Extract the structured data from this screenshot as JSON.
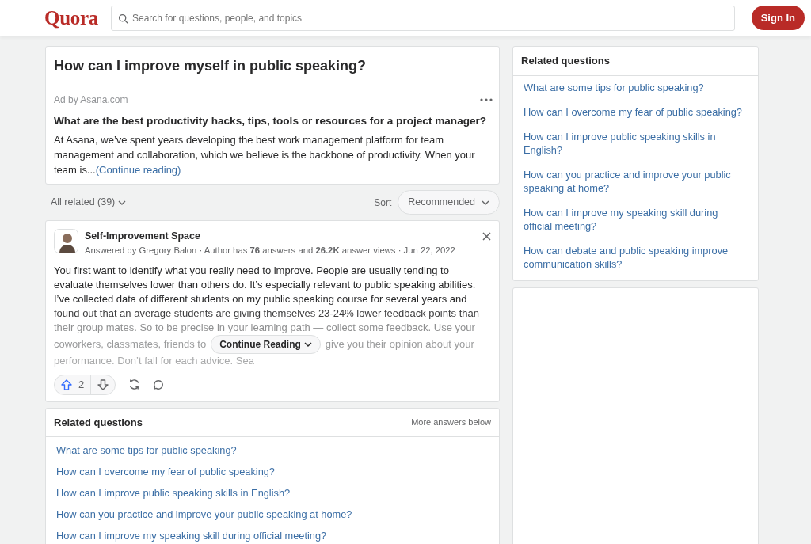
{
  "header": {
    "logo": "Quora",
    "search": {
      "placeholder": "Search for questions, people, and topics"
    },
    "sign_in": "Sign In"
  },
  "question": {
    "title": "How can I improve myself in public speaking?"
  },
  "ad": {
    "source": "Ad by Asana.com",
    "title": "What are the best productivity hacks, tips, tools or resources for a project manager?",
    "text": "At Asana, we’ve spent years developing the best work management platform for team management and collaboration, which we believe is the backbone of productivity. When your team is...",
    "link": "(Continue reading)"
  },
  "filter": {
    "label": "All related (39)",
    "sort_label": "Sort",
    "sort_value": "Recommended"
  },
  "answer": {
    "name": "Self-Improvement Space",
    "meta": "Answered by Gregory Balon · Author has **76** answers and **26.2K** answer views · Jun 22, 2022",
    "lines": [
      {
        "text": "You first want to identify what you really need to improve. People are usually tending to"
      },
      {
        "text": "evaluate themselves lower than others do. It’s especially relevant to public speaking abilities."
      },
      {
        "text": "I’ve collected data of different students on my public speaking course for several years and"
      },
      {
        "text": "found out that an average students are giving themselves 23-24% lower feedback points than"
      },
      {
        "text": "their group mates. So to be precise in your learning path — collect some feedback. Use your"
      }
    ],
    "cut_left": "coworkers, classmates, friends to",
    "cut_right": "give you their opinion about your",
    "last_line": "performance. Don’t fall for each advice. Sea",
    "continue": "Continue Reading",
    "upvotes": "2"
  },
  "related_inline": {
    "title": "Related questions",
    "note": "More answers below",
    "items": [
      "What are some tips for public speaking?",
      "How can I overcome my fear of public speaking?",
      "How can I improve public speaking skills in English?",
      "How can you practice and improve your public speaking at home?",
      "How can I improve my speaking skill during official meeting?"
    ]
  },
  "sidebar": {
    "title": "Related questions",
    "items": [
      "What are some tips for public speaking?",
      "How can I overcome my fear of public speaking?",
      "How can I improve public speaking skills in English?",
      "How can you practice and improve your public speaking at home?",
      "How can I improve my speaking skill during official meeting?",
      "How can debate and public speaking improve communication skills?"
    ]
  }
}
